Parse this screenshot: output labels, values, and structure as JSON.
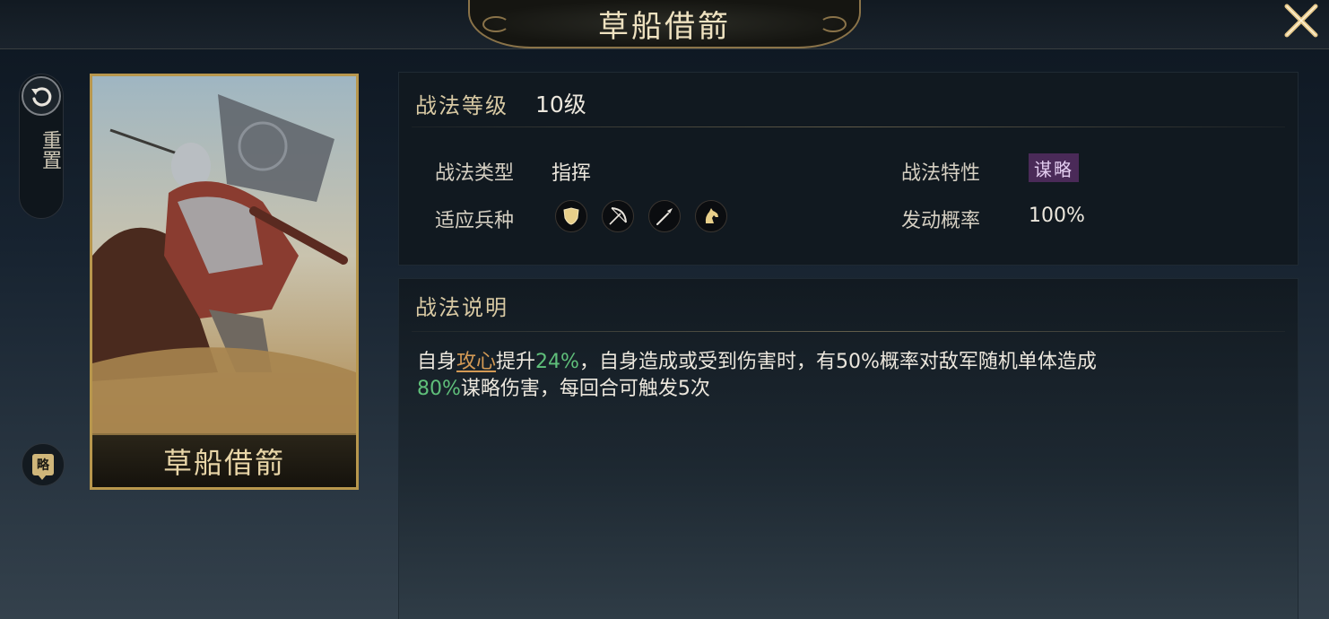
{
  "header": {
    "title": "草船借箭"
  },
  "left_rail": {
    "reset_label": "重置",
    "strategy_badge": "略"
  },
  "card": {
    "name": "草船借箭"
  },
  "info": {
    "level_label": "战法等级",
    "level_value": "10级",
    "type_label": "战法类型",
    "type_value": "指挥",
    "trait_label": "战法特性",
    "trait_value": "谋略",
    "troops_label": "适应兵种",
    "troops": [
      "shield-icon",
      "bow-icon",
      "spear-icon",
      "horse-icon"
    ],
    "rate_label": "发动概率",
    "rate_value": "100%"
  },
  "description": {
    "heading": "战法说明",
    "parts": {
      "p1": "自身",
      "kw": "攻心",
      "p2": "提升",
      "n1": "24%",
      "p3": "，自身造成或受到伤害时，有50%概率对敌军随机单体造成",
      "n2": "80%",
      "p4": "谋略伤害，每回合可触发5次"
    }
  },
  "colors": {
    "accent_gold": "#b8974d",
    "highlight_green": "#5fbf7a",
    "keyword_orange": "#d49a55",
    "trait_purple": "#4a2a58"
  }
}
